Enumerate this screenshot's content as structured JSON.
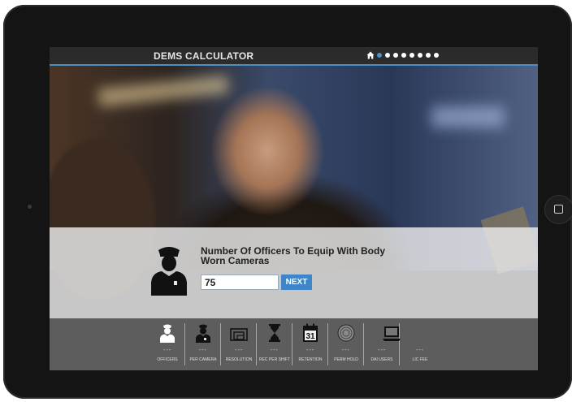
{
  "app": {
    "title": "DEMS CALCULATOR"
  },
  "nav": {
    "home_icon": "home-icon",
    "page_count": 8,
    "active_page": 1
  },
  "question": {
    "text": "Number Of Officers To Equip With Body Worn Cameras",
    "input_value": "75",
    "next_label": "NEXT",
    "icon": "police-officer-icon"
  },
  "steps": [
    {
      "label": "OFFICERS",
      "value": "---",
      "icon": "officer-icon"
    },
    {
      "label": "PER CAMERA",
      "value": "---",
      "icon": "camera-officer-icon"
    },
    {
      "label": "RESOLUTION",
      "value": "---",
      "icon": "screens-icon"
    },
    {
      "label": "REC PER SHIFT",
      "value": "---",
      "icon": "hourglass-icon"
    },
    {
      "label": "RETENTION",
      "value": "---",
      "icon": "calendar-icon"
    },
    {
      "label": "PERM HOLD",
      "value": "---",
      "icon": "disc-icon"
    },
    {
      "label": "DAI USERS",
      "value": "---",
      "icon": "laptop-icon"
    },
    {
      "label": "LIC FEE",
      "value": "---",
      "icon": "license-icon"
    }
  ],
  "calendar_day": "31",
  "colors": {
    "accent": "#3e86c8",
    "topbar": "#2b2b2b",
    "panel": "#ececec"
  }
}
